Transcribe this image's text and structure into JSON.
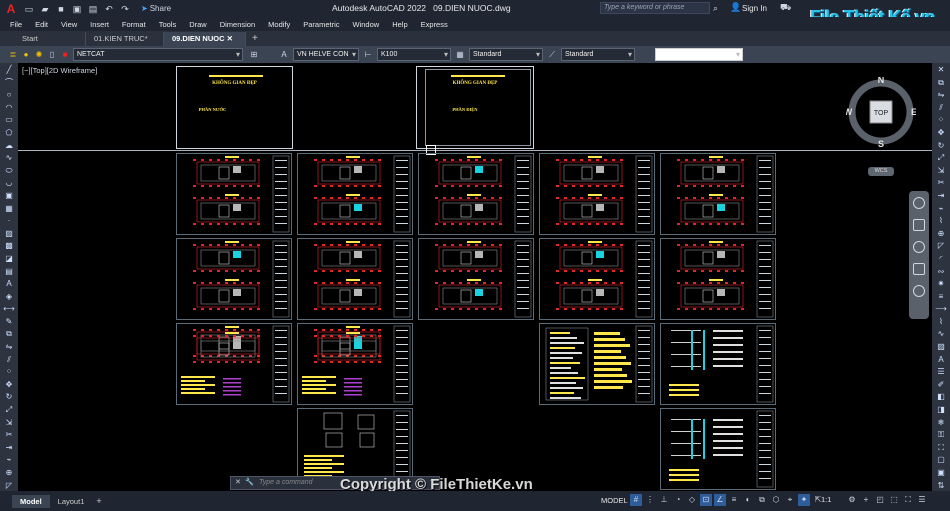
{
  "titlebar": {
    "app_letter": "A",
    "share_label": "Share",
    "app_name": "Autodesk AutoCAD 2022",
    "filename": "09.DIEN NUOC.dwg",
    "search_placeholder": "Type a keyword or phrase",
    "signin_label": "Sign In",
    "logo_text": "File Thiết Kế.vn"
  },
  "menu": [
    "File",
    "Edit",
    "View",
    "Insert",
    "Format",
    "Tools",
    "Draw",
    "Dimension",
    "Modify",
    "Parametric",
    "Window",
    "Help",
    "Express"
  ],
  "tabs": [
    {
      "label": "Start",
      "active": false
    },
    {
      "label": "01.KIEN TRUC*",
      "active": false
    },
    {
      "label": "09.DIEN NUOC",
      "active": true
    }
  ],
  "toolbar": {
    "layer": "NETCAT",
    "text_style": "VN HELVE CON",
    "text_height": "K100",
    "dim_style": "Standard",
    "table_style": "Standard"
  },
  "viewport_label": "[−][Top][2D Wireframe]",
  "covers": [
    {
      "title": "KHÔNG GIAN ĐẸP",
      "subtitle": "PHẦN NƯỚC"
    },
    {
      "title": "KHÔNG GIAN ĐẸP",
      "subtitle": "PHẦN ĐIỆN"
    }
  ],
  "viewcube": {
    "north": "N",
    "south": "S",
    "east": "E",
    "west": "W",
    "face": "TOP",
    "ucs": "WCS"
  },
  "command": {
    "placeholder": "Type a command"
  },
  "watermark": "Copyright © FileThietKe.vn",
  "status": {
    "layout_tabs": [
      {
        "label": "Model",
        "active": true
      },
      {
        "label": "Layout1",
        "active": false
      }
    ],
    "mode": "MODEL",
    "scale": "1:1"
  },
  "colors": {
    "accent": "#2d5d9b",
    "cad_yellow": "#ffe64a",
    "cad_red": "#e3262a",
    "cad_cyan": "#19d4e0"
  }
}
